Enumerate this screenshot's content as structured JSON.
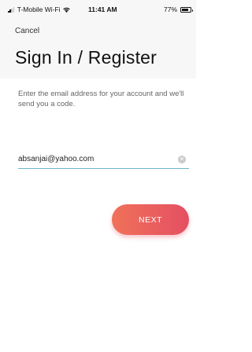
{
  "status_bar": {
    "carrier": "T-Mobile Wi-Fi",
    "time": "11:41 AM",
    "battery_percent": "77%",
    "battery_level": 0.77,
    "wifi_icon": "wifi-icon",
    "signal_icon": "signal-bars-icon"
  },
  "header": {
    "cancel_label": "Cancel",
    "title": "Sign In / Register"
  },
  "main": {
    "instructions": "Enter the email address for your account and we'll send you a code.",
    "email_value": "absanjai@yahoo.com",
    "clear_icon": "clear-circle-icon",
    "next_label": "NEXT"
  },
  "colors": {
    "header_background": "#f7f7f7",
    "input_underline": "#6fb3cf",
    "button_gradient_start": "#f07159",
    "button_gradient_end": "#e44f62",
    "button_text": "#ffffff"
  }
}
